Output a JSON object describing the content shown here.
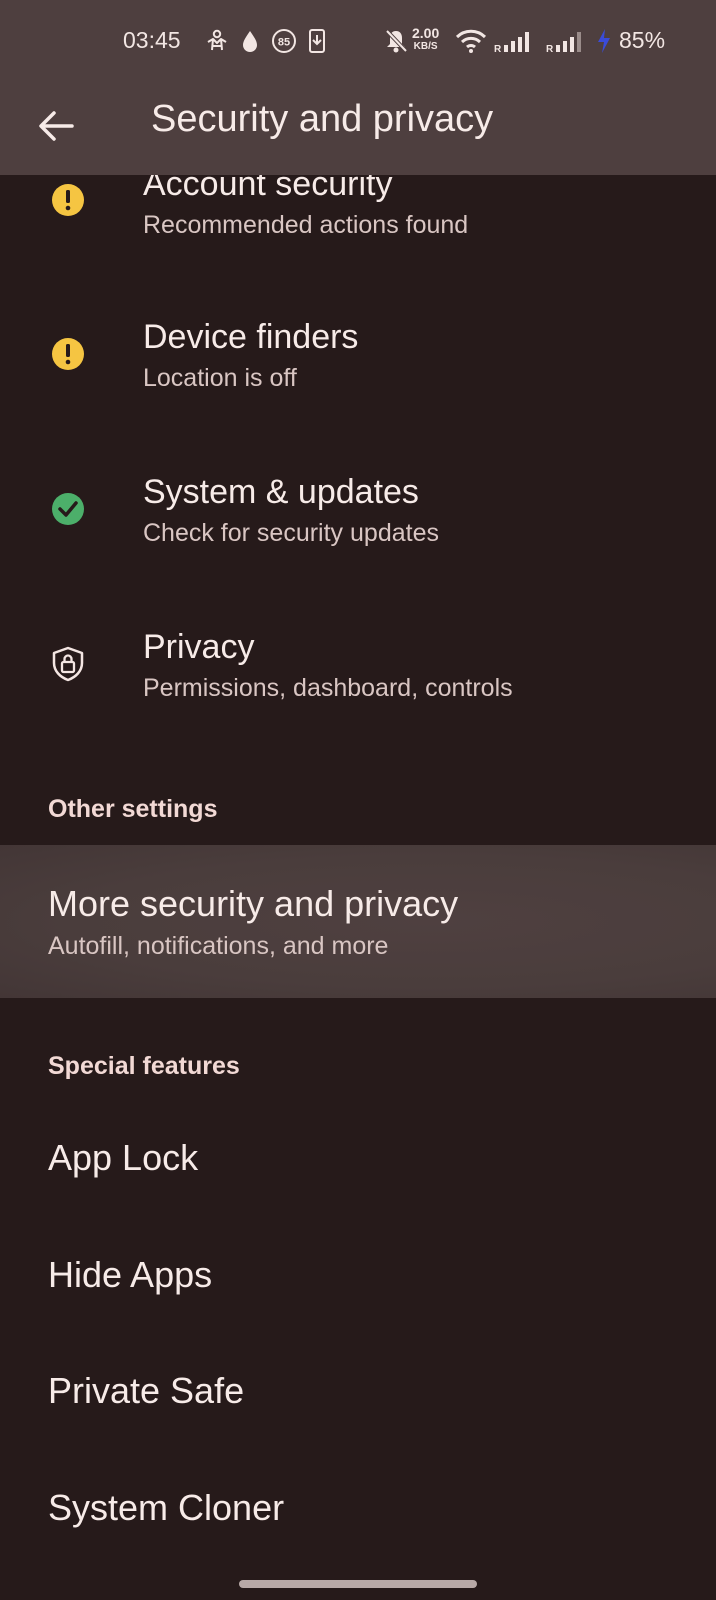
{
  "status_bar": {
    "time": "03:45",
    "net_speed_value": "2.00",
    "net_speed_unit": "KB/S",
    "notification_badge": "85",
    "battery_percent": "85%",
    "icons": [
      "accessibility-icon",
      "water-drop-icon",
      "badge-85-icon",
      "download-icon",
      "bell-off-icon",
      "wifi-icon",
      "signal-r-icon",
      "signal-r-icon",
      "charging-icon"
    ]
  },
  "appbar": {
    "title": "Security and privacy"
  },
  "status_items": [
    {
      "title": "Account security",
      "subtitle": "Recommended actions found",
      "icon": "warning-icon",
      "icon_color": "#f5c542"
    },
    {
      "title": "Device finders",
      "subtitle": "Location is off",
      "icon": "warning-icon",
      "icon_color": "#f5c542"
    },
    {
      "title": "System & updates",
      "subtitle": "Check for security updates",
      "icon": "check-icon",
      "icon_color": "#4caf6a"
    },
    {
      "title": "Privacy",
      "subtitle": "Permissions, dashboard, controls",
      "icon": "shield-lock-icon",
      "icon_color": "#f4e6e3"
    }
  ],
  "other_settings": {
    "header": "Other settings",
    "item": {
      "title": "More security and privacy",
      "subtitle": "Autofill, notifications, and more"
    }
  },
  "special_features": {
    "header": "Special features",
    "items": [
      "App Lock",
      "Hide Apps",
      "Private Safe",
      "System Cloner"
    ]
  },
  "colors": {
    "background": "#261a1a",
    "header_background": "#4e3f3f",
    "highlight_background": "#4a3d3c",
    "warning": "#f5c542",
    "ok": "#4caf6a"
  }
}
